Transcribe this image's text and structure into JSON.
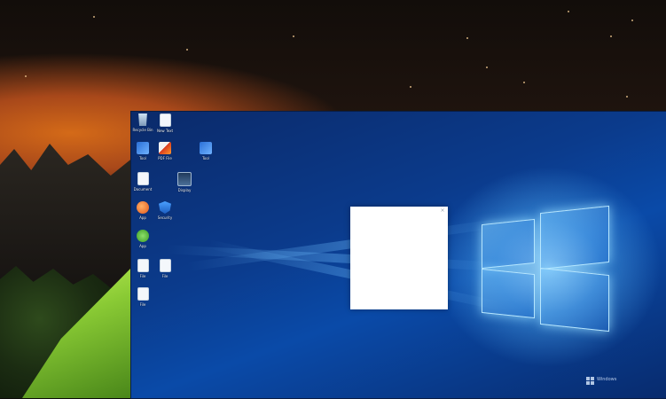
{
  "host": {
    "wallpaper": "night sky over mountains with green tent",
    "accent": "#d46a18"
  },
  "remote": {
    "wallpaper": "windows-10-hero",
    "accent": "#0a4aa8",
    "icons": [
      {
        "name": "recycle-bin-icon",
        "glyph": "g-recycle",
        "label": "Recycle Bin"
      },
      {
        "name": "document-icon",
        "glyph": "g-doc",
        "label": "New Text"
      },
      {
        "name": "app-icon",
        "glyph": "g-app",
        "label": "Tool"
      },
      {
        "name": "pdf-icon",
        "glyph": "g-pdf",
        "label": "PDF File"
      },
      {
        "name": "app-icon",
        "glyph": "g-app",
        "label": "Tool"
      },
      {
        "name": "document-icon",
        "glyph": "g-doc",
        "label": "Document"
      },
      {
        "name": "monitor-icon",
        "glyph": "g-monitor",
        "label": "Display"
      },
      {
        "name": "orange-app-icon",
        "glyph": "g-orange",
        "label": "App"
      },
      {
        "name": "shield-icon",
        "glyph": "g-shield",
        "label": "Security"
      },
      {
        "name": "green-app-icon",
        "glyph": "g-green",
        "label": "App"
      },
      {
        "name": "document-icon",
        "glyph": "g-doc",
        "label": "File"
      },
      {
        "name": "document-icon",
        "glyph": "g-doc",
        "label": "File"
      },
      {
        "name": "document-icon",
        "glyph": "g-doc",
        "label": "File"
      }
    ],
    "blank_window": {
      "close_glyph": "×"
    },
    "watermark": {
      "line1": "Windows",
      "line2": " "
    }
  }
}
